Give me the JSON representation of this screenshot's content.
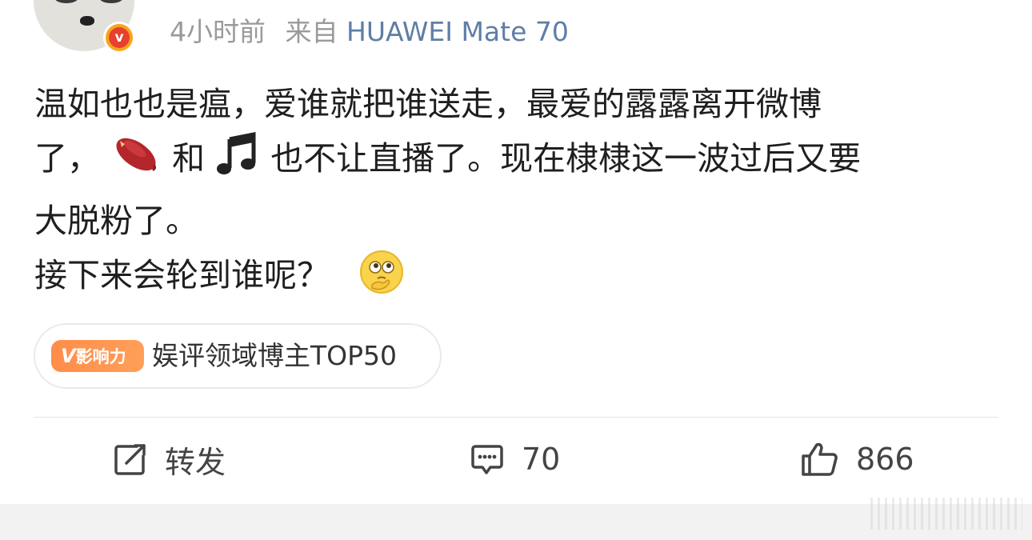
{
  "post": {
    "time": "4小时前",
    "from_label": "来自",
    "device": "HUAWEI Mate 70",
    "verified_badge": "v",
    "text": {
      "line1": "温如也也是瘟，爱谁就把谁送走，最爱的露露离开微博",
      "line2_a": "了，",
      "line2_b": "和",
      "line2_c": "也不让直播了。现在棣棣这一波过后又要",
      "line3": "大脱粉了。",
      "line4": "接下来会轮到谁呢？"
    },
    "emojis": [
      "sweet-potato-icon",
      "music-note-icon",
      "thinking-face-icon"
    ]
  },
  "influence_chip": {
    "badge_mark": "V",
    "badge_text": "影响力",
    "label": "娱评领域博主TOP50"
  },
  "actions": {
    "repost_label": "转发",
    "comment_count": "70",
    "like_count": "866"
  },
  "colors": {
    "meta_gray": "#9a9a9a",
    "device_blue": "#5f7ea6",
    "badge_orange": "#ff8d4a",
    "verified_red": "#e8402c"
  }
}
